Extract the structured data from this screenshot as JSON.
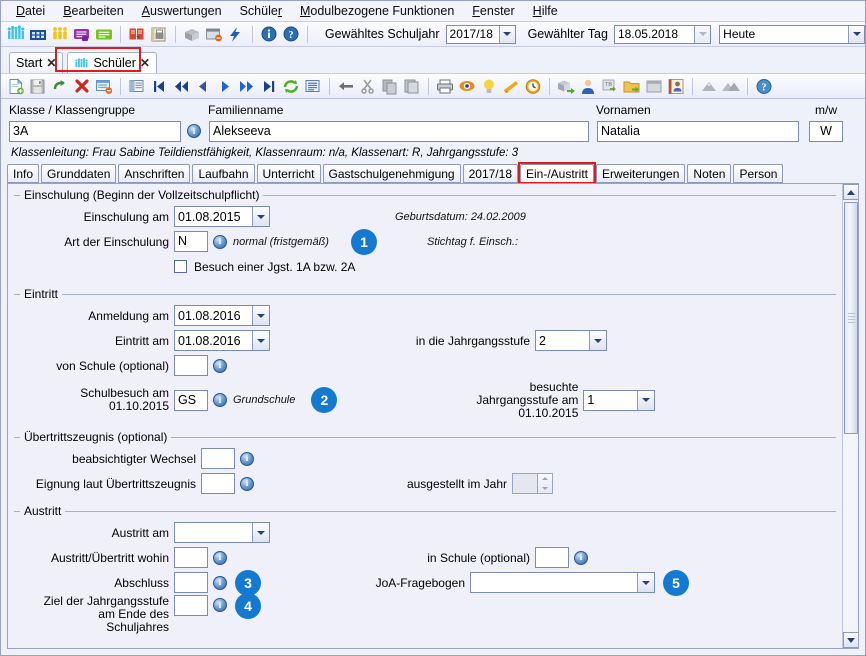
{
  "menu": {
    "items": [
      {
        "label": "Datei",
        "accel": "D"
      },
      {
        "label": "Bearbeiten",
        "accel": "B"
      },
      {
        "label": "Auswertungen",
        "accel": "A"
      },
      {
        "label": "Schüler",
        "accel": "r"
      },
      {
        "label": "Modulbezogene Funktionen",
        "accel": "M"
      },
      {
        "label": "Fenster",
        "accel": "F"
      },
      {
        "label": "Hilfe",
        "accel": "H"
      }
    ]
  },
  "toolbar_top": {
    "icons": [
      "group-people-icon",
      "school-building-icon",
      "persons-yellow-icon",
      "purple-note-icon",
      "green-note-icon",
      "red-book-icon",
      "printer-report-icon",
      "package-grey-icon",
      "window-minus-icon",
      "lightning-icon",
      "info-icon",
      "help-icon"
    ],
    "schuljahr_label": "Gewähltes Schuljahr",
    "schuljahr_value": "2017/18",
    "tag_label": "Gewählter Tag",
    "tag_value": "18.05.2018",
    "heute_value": "Heute"
  },
  "window_tabs": [
    {
      "label": "Start",
      "selected": false,
      "has_icon": false,
      "highlighted": false
    },
    {
      "label": "Schüler",
      "selected": true,
      "has_icon": true,
      "highlighted": true
    }
  ],
  "toolbar_second": {
    "icons": [
      "new-document-icon",
      "save-icon",
      "undo-icon",
      "delete-red-x-icon",
      "form-minus-icon",
      "list-detail-icon",
      "first-record-icon",
      "fast-rewind-icon",
      "previous-record-icon",
      "next-record-icon",
      "fast-forward-icon",
      "last-record-icon",
      "refresh-icon",
      "list-icon",
      "back-arrow-icon",
      "cut-icon",
      "copy-icon",
      "paste-icon",
      "print-icon",
      "preview-eye-icon",
      "bulb-icon",
      "cone-filter-icon",
      "clock-icon",
      "package-export-icon",
      "person-blue-icon",
      "tb-transfer-icon",
      "folder-export-icon",
      "window-grey-icon",
      "id-card-icon",
      "mountain-icon",
      "mountains-icon",
      "help-round-icon"
    ]
  },
  "header": {
    "klasse_label": "Klasse / Klassengruppe",
    "klasse_value": "3A",
    "familienname_label": "Familienname",
    "familienname_value": "Alekseeva",
    "vornamen_label": "Vornamen",
    "vornamen_value": "Natalia",
    "mw_label": "m/w",
    "mw_value": "W",
    "klassenleitung": "Klassenleitung: Frau Sabine Teildienstfähigkeit, Klassenraum: n/a, Klassenart: R, Jahrgangsstufe: 3"
  },
  "inner_tabs": [
    {
      "label": "Info",
      "selected": false,
      "highlighted": false
    },
    {
      "label": "Grunddaten",
      "selected": false,
      "highlighted": false
    },
    {
      "label": "Anschriften",
      "selected": false,
      "highlighted": false
    },
    {
      "label": "Laufbahn",
      "selected": false,
      "highlighted": false
    },
    {
      "label": "Unterricht",
      "selected": false,
      "highlighted": false
    },
    {
      "label": "Gastschulgenehmigung",
      "selected": false,
      "highlighted": false
    },
    {
      "label": "2017/18",
      "selected": false,
      "highlighted": false
    },
    {
      "label": "Ein-/Austritt",
      "selected": true,
      "highlighted": true
    },
    {
      "label": "Erweiterungen",
      "selected": false,
      "highlighted": false
    },
    {
      "label": "Noten",
      "selected": false,
      "highlighted": false
    },
    {
      "label": "Person",
      "selected": false,
      "highlighted": false
    }
  ],
  "einschulung": {
    "legend": "Einschulung (Beginn der Vollzeitschulpflicht)",
    "einschulung_am_label": "Einschulung am",
    "einschulung_am_value": "01.08.2015",
    "geburtsdatum_text": "Geburtsdatum: 24.02.2009",
    "art_label": "Art der Einschulung",
    "art_value": "N",
    "art_hint": "normal (fristgemäß)",
    "stichtag_text": "Stichtag f. Einsch.:",
    "badge_1": "1",
    "checkbox_label": "Besuch einer Jgst. 1A bzw. 2A",
    "checkbox_checked": false
  },
  "eintritt": {
    "legend": "Eintritt",
    "anmeldung_label": "Anmeldung am",
    "anmeldung_value": "01.08.2016",
    "eintritt_label": "Eintritt am",
    "eintritt_value": "01.08.2016",
    "jahrgangsstufe_label": "in die Jahrgangsstufe",
    "jahrgangsstufe_value": "2",
    "von_schule_label": "von Schule (optional)",
    "von_schule_value": "",
    "schulbesuch_label_1": "Schulbesuch am",
    "schulbesuch_label_2": "01.10.2015",
    "schulbesuch_value": "GS",
    "schulbesuch_hint": "Grundschule",
    "badge_2": "2",
    "besuchte_label_1": "besuchte",
    "besuchte_label_2": "Jahrgangsstufe am",
    "besuchte_label_3": "01.10.2015",
    "besuchte_value": "1"
  },
  "uebertritt": {
    "legend": "Übertrittszeugnis (optional)",
    "wechsel_label": "beabsichtigter Wechsel",
    "wechsel_value": "",
    "eignung_label": "Eignung laut Übertrittszeugnis",
    "eignung_value": "",
    "jahr_label": "ausgestellt im Jahr",
    "jahr_value": ""
  },
  "austritt": {
    "legend": "Austritt",
    "austritt_am_label": "Austritt am",
    "austritt_am_value": "",
    "wohin_label": "Austritt/Übertritt wohin",
    "wohin_value": "",
    "in_schule_label": "in Schule (optional)",
    "in_schule_value": "",
    "abschluss_label": "Abschluss",
    "abschluss_value": "",
    "badge_3": "3",
    "joa_label": "JoA-Fragebogen",
    "joa_value": "",
    "badge_5": "5",
    "ziel_label_1": "Ziel der Jahrgangsstufe",
    "ziel_label_2": "am Ende des",
    "ziel_label_3": "Schuljahres",
    "ziel_value": "",
    "badge_4": "4"
  },
  "colors": {
    "accent_blue": "#1479d0",
    "highlight_red": "#e01b1b",
    "panel_bg": "#f0f0fb",
    "window_bg": "#eef0fa"
  }
}
